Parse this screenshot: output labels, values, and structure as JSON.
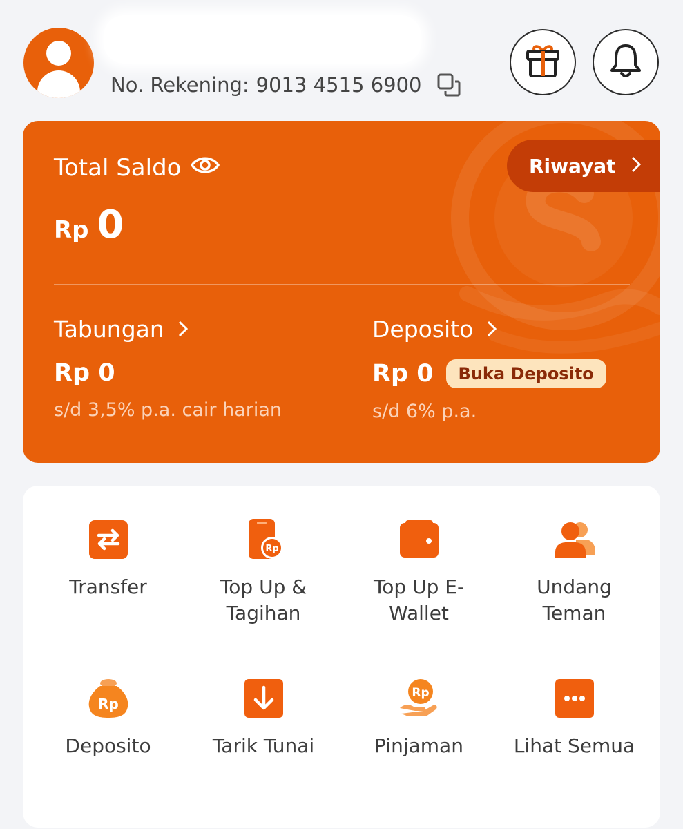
{
  "header": {
    "account_label": "No. Rekening:",
    "account_number": "9013 4515 6900"
  },
  "balance": {
    "title": "Total Saldo",
    "currency": "Rp",
    "amount": "0",
    "history_label": "Riwayat"
  },
  "tabungan": {
    "title": "Tabungan",
    "amount": "Rp 0",
    "rate": "s/d 3,5% p.a. cair harian"
  },
  "deposito": {
    "title": "Deposito",
    "amount": "Rp 0",
    "open_label": "Buka Deposito",
    "rate": "s/d 6% p.a."
  },
  "menu": [
    {
      "label": "Transfer",
      "icon": "transfer-icon"
    },
    {
      "label": "Top Up & Tagihan",
      "icon": "phone-rp-icon"
    },
    {
      "label": "Top Up E-Wallet",
      "icon": "wallet-icon"
    },
    {
      "label": "Undang Teman",
      "icon": "people-icon"
    },
    {
      "label": "Deposito",
      "icon": "money-bag-icon"
    },
    {
      "label": "Tarik Tunai",
      "icon": "withdraw-icon"
    },
    {
      "label": "Pinjaman",
      "icon": "hand-coin-icon"
    },
    {
      "label": "Lihat Semua",
      "icon": "more-icon"
    }
  ],
  "colors": {
    "accent": "#e8600a",
    "accent_dark": "#c33d06",
    "background": "#f3f4f7",
    "badge_bg": "#fde4bd",
    "badge_text": "#8a2a08"
  }
}
